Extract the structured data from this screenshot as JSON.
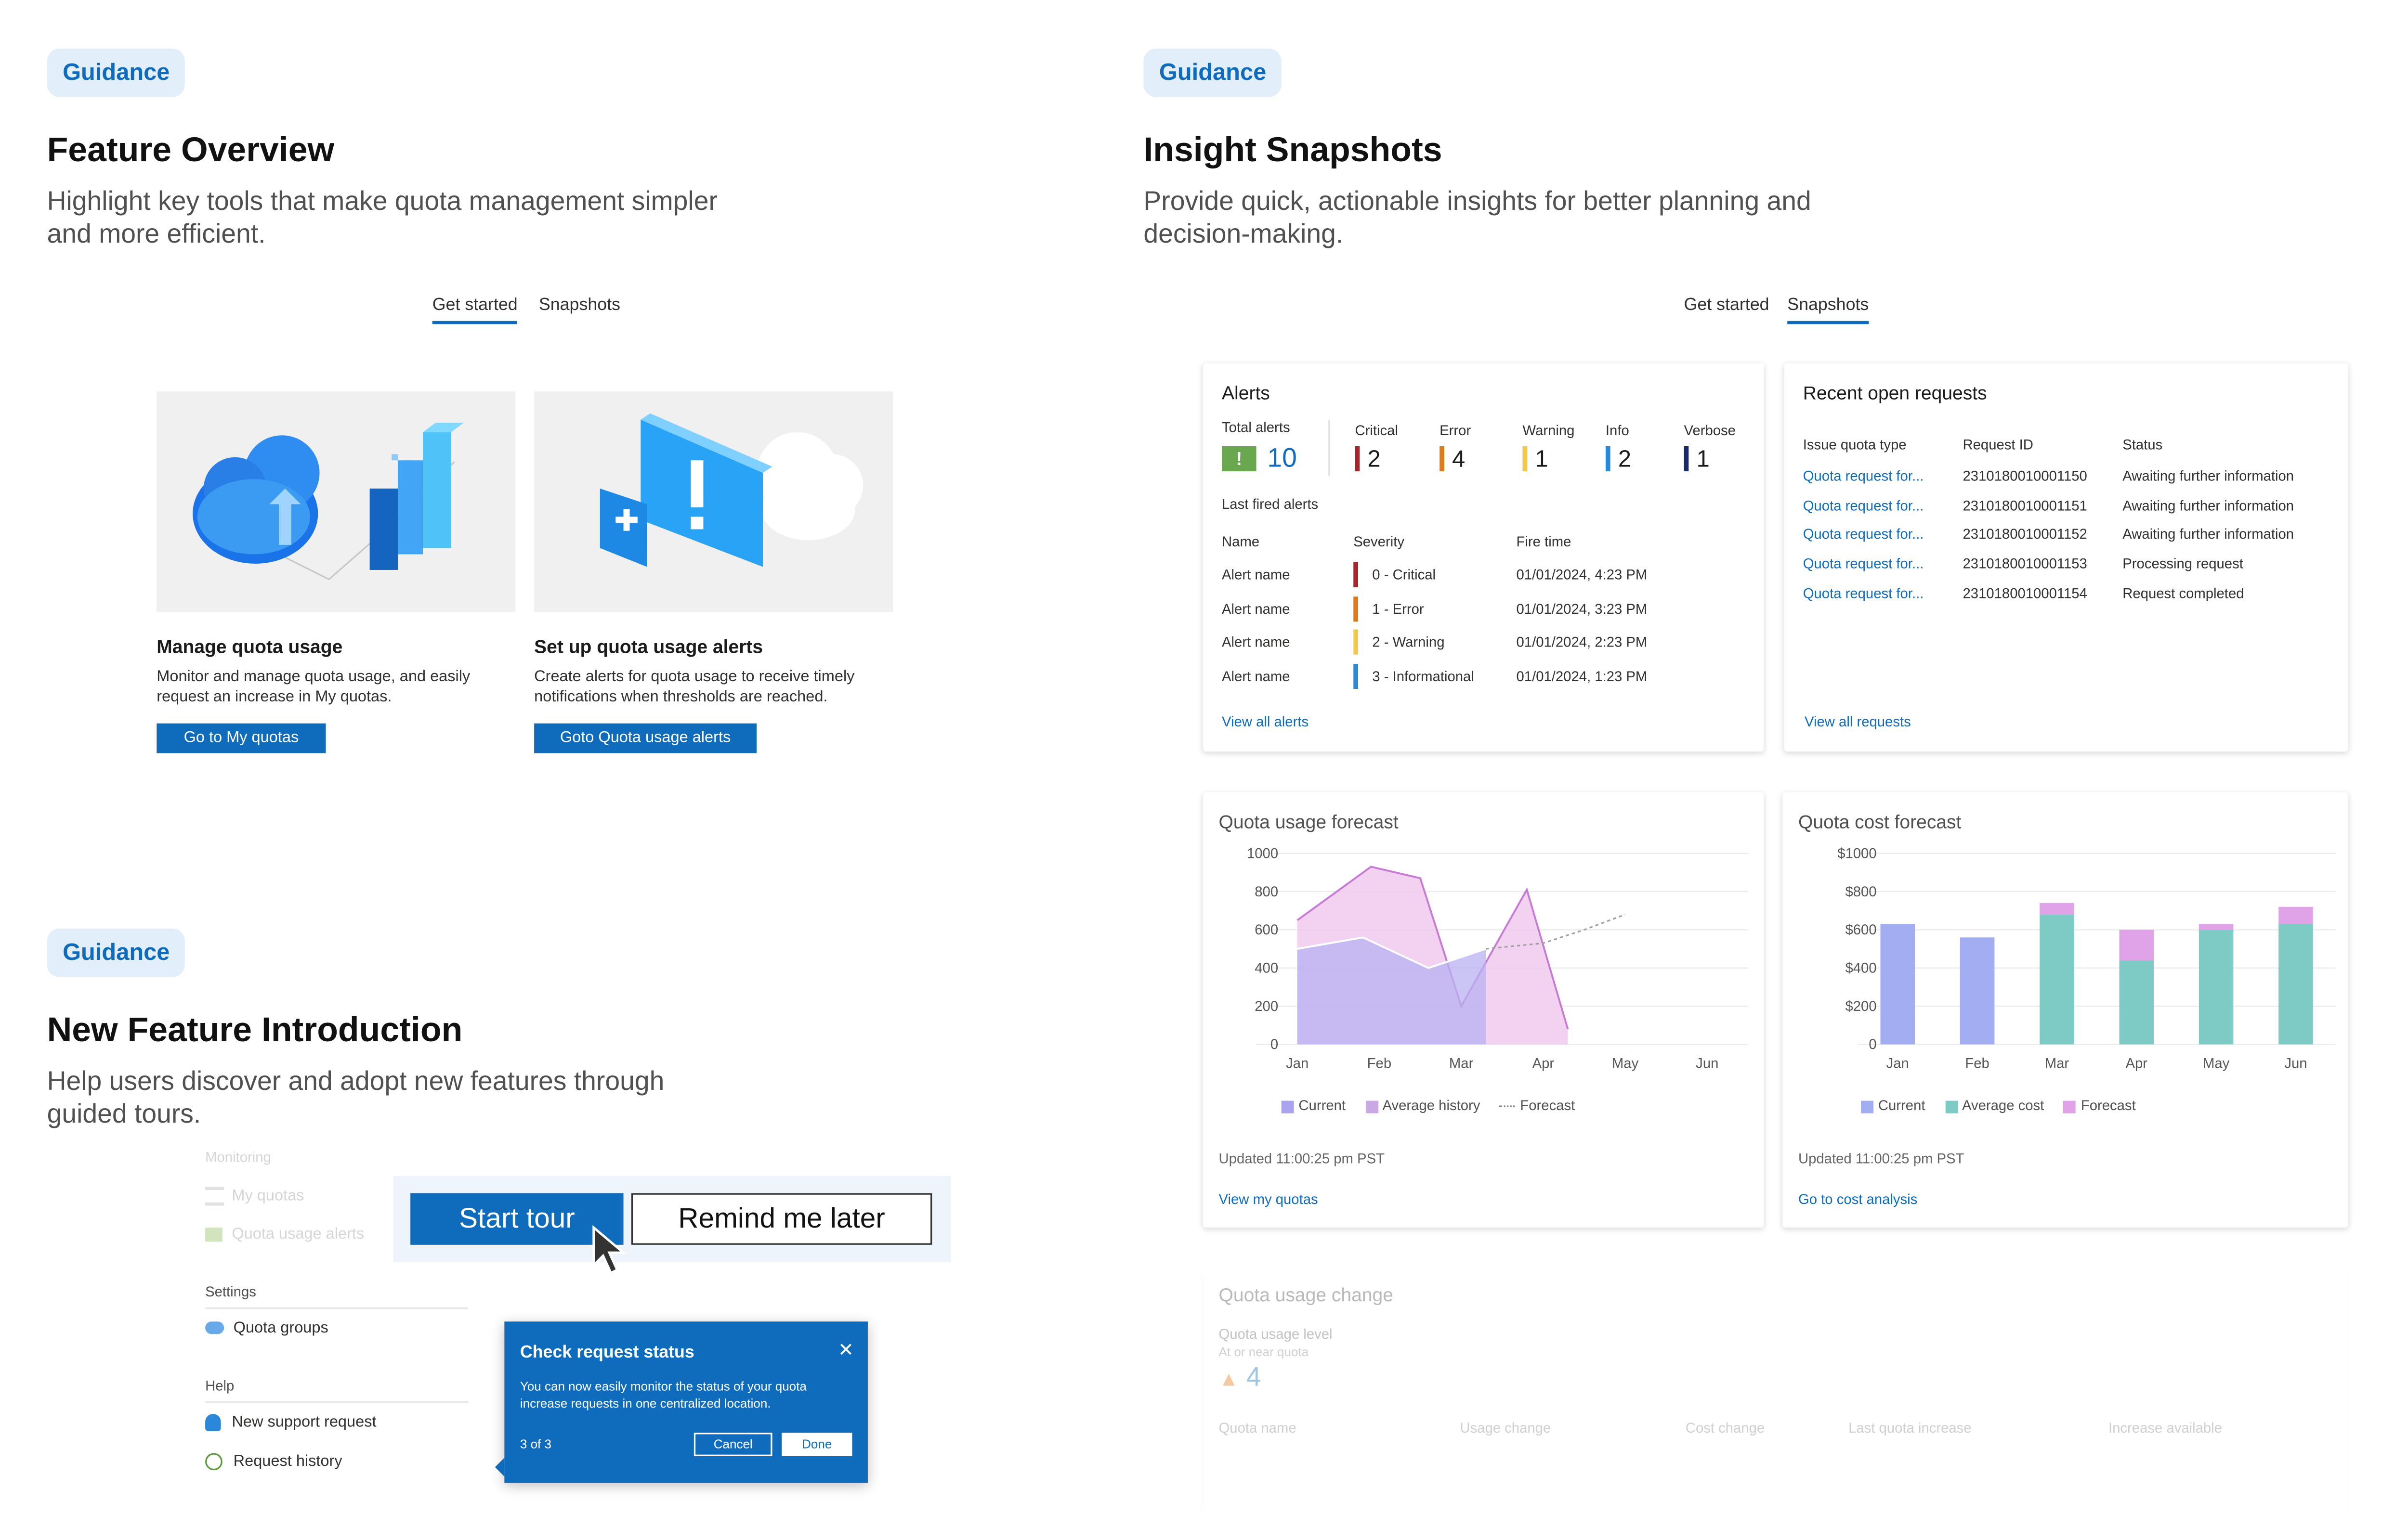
{
  "sections": {
    "overview": {
      "tag": "Guidance",
      "title": "Feature Overview",
      "subtitle": "Highlight key tools that make quota management simpler and more efficient."
    },
    "snapshots": {
      "tag": "Guidance",
      "title": "Insight Snapshots",
      "subtitle": "Provide quick, actionable insights for better planning and decision-making."
    },
    "intro": {
      "tag": "Guidance",
      "title": "New Feature Introduction",
      "subtitle": "Help users discover and adopt new features through guided tours."
    }
  },
  "tabs": {
    "get_started": "Get started",
    "snapshots": "Snapshots"
  },
  "cards": [
    {
      "title": "Manage quota usage",
      "desc": "Monitor and manage quota usage, and easily request an increase in My quotas.",
      "button": "Go to My quotas"
    },
    {
      "title": "Set up quota usage alerts",
      "desc": "Create alerts for quota usage to receive timely notifications when thresholds are reached.",
      "button": "Goto Quota usage alerts"
    }
  ],
  "alerts": {
    "title": "Alerts",
    "total_label": "Total alerts",
    "total": "10",
    "counts": [
      {
        "label": "Critical",
        "value": "2",
        "color": "#a4262c"
      },
      {
        "label": "Error",
        "value": "4",
        "color": "#e07b1d"
      },
      {
        "label": "Warning",
        "value": "1",
        "color": "#f2c94c"
      },
      {
        "label": "Info",
        "value": "2",
        "color": "#2b88d8"
      },
      {
        "label": "Verbose",
        "value": "1",
        "color": "#1b2a6b"
      }
    ],
    "last_fired": "Last fired alerts",
    "headers": [
      "Name",
      "Severity",
      "Fire time"
    ],
    "rows": [
      {
        "name": "Alert name",
        "severity": "0 - Critical",
        "time": "01/01/2024, 4:23 PM",
        "color": "#a4262c"
      },
      {
        "name": "Alert name",
        "severity": "1 - Error",
        "time": "01/01/2024, 3:23 PM",
        "color": "#e07b1d"
      },
      {
        "name": "Alert name",
        "severity": "2 - Warning",
        "time": "01/01/2024, 2:23 PM",
        "color": "#f2c94c"
      },
      {
        "name": "Alert name",
        "severity": "3 - Informational",
        "time": "01/01/2024, 1:23 PM",
        "color": "#2b88d8"
      }
    ],
    "link": "View all alerts"
  },
  "requests": {
    "title": "Recent open requests",
    "headers": [
      "Issue quota type",
      "Request ID",
      "Status"
    ],
    "rows": [
      {
        "type": "Quota request for...",
        "id": "2310180010001150",
        "status": "Awaiting further information"
      },
      {
        "type": "Quota request for...",
        "id": "2310180010001151",
        "status": "Awaiting further information"
      },
      {
        "type": "Quota request for...",
        "id": "2310180010001152",
        "status": "Awaiting further information"
      },
      {
        "type": "Quota request for...",
        "id": "2310180010001153",
        "status": "Processing request"
      },
      {
        "type": "Quota request for...",
        "id": "2310180010001154",
        "status": "Request completed"
      }
    ],
    "link": "View all requests"
  },
  "usage_forecast": {
    "title": "Quota usage forecast",
    "updated": "Updated 11:00:25 pm PST",
    "link": "View my quotas",
    "legend": [
      "Current",
      "Average history",
      "Forecast"
    ]
  },
  "cost_forecast": {
    "title": "Quota cost forecast",
    "updated": "Updated 11:00:25 pm PST",
    "link": "Go to cost analysis",
    "legend": [
      "Current",
      "Average cost",
      "Forecast"
    ]
  },
  "usage_change": {
    "title": "Quota usage change",
    "level_label": "Quota usage level",
    "level_sub": "At or near quota",
    "level_value": "4",
    "headers": [
      "Quota name",
      "Usage change",
      "Cost change",
      "Last quota increase",
      "Increase available"
    ]
  },
  "tour": {
    "start": "Start tour",
    "later": "Remind me later",
    "nav": {
      "section1": "Monitoring",
      "items1": [
        "My quotas",
        "Quota usage alerts"
      ],
      "section2": "Settings",
      "items2": [
        "Quota groups"
      ],
      "section3": "Help",
      "items3": [
        "New support request",
        "Request history"
      ]
    },
    "popup": {
      "title": "Check request status",
      "body": "You can now easily monitor the status of your quota increase requests in one centralized location.",
      "step": "3 of 3",
      "cancel": "Cancel",
      "done": "Done"
    }
  },
  "chart_data": [
    {
      "type": "area",
      "title": "Quota usage forecast",
      "categories": [
        "Jan",
        "Feb",
        "Mar",
        "Apr",
        "May",
        "Jun"
      ],
      "ylim": [
        0,
        1000
      ],
      "yticks": [
        "1000",
        "800",
        "600",
        "400",
        "200",
        "0"
      ],
      "series": [
        {
          "name": "Current",
          "x": [
            0,
            0.8,
            1.6,
            2.3
          ],
          "values": [
            500,
            560,
            400,
            500
          ],
          "color": "#a9a3f0"
        },
        {
          "name": "Average history",
          "x": [
            0,
            0.9,
            1.5,
            2.0,
            2.8,
            3.3
          ],
          "values": [
            650,
            930,
            870,
            200,
            810,
            80
          ],
          "color": "#c77bd4"
        },
        {
          "name": "Forecast",
          "x": [
            2.3,
            3.0,
            3.5,
            4.0
          ],
          "values": [
            500,
            530,
            600,
            680
          ],
          "color": "#a0a0a0"
        }
      ],
      "legend": "bottom",
      "grid": true
    },
    {
      "type": "bar",
      "title": "Quota cost forecast",
      "categories": [
        "Jan",
        "Feb",
        "Mar",
        "Apr",
        "May",
        "Jun"
      ],
      "ylim": [
        0,
        1000
      ],
      "yticks": [
        "$1000",
        "$800",
        "$600",
        "$400",
        "$200",
        "0"
      ],
      "series": [
        {
          "name": "Current",
          "values": [
            630,
            560,
            0,
            0,
            0,
            0
          ],
          "color": "#a3adf2"
        },
        {
          "name": "Average cost",
          "values": [
            0,
            0,
            680,
            440,
            600,
            630
          ],
          "color": "#7ecac5"
        },
        {
          "name": "Forecast",
          "values": [
            0,
            0,
            60,
            160,
            30,
            90
          ],
          "color": "#e0a3e8"
        }
      ],
      "legend": "bottom",
      "grid": true
    }
  ]
}
